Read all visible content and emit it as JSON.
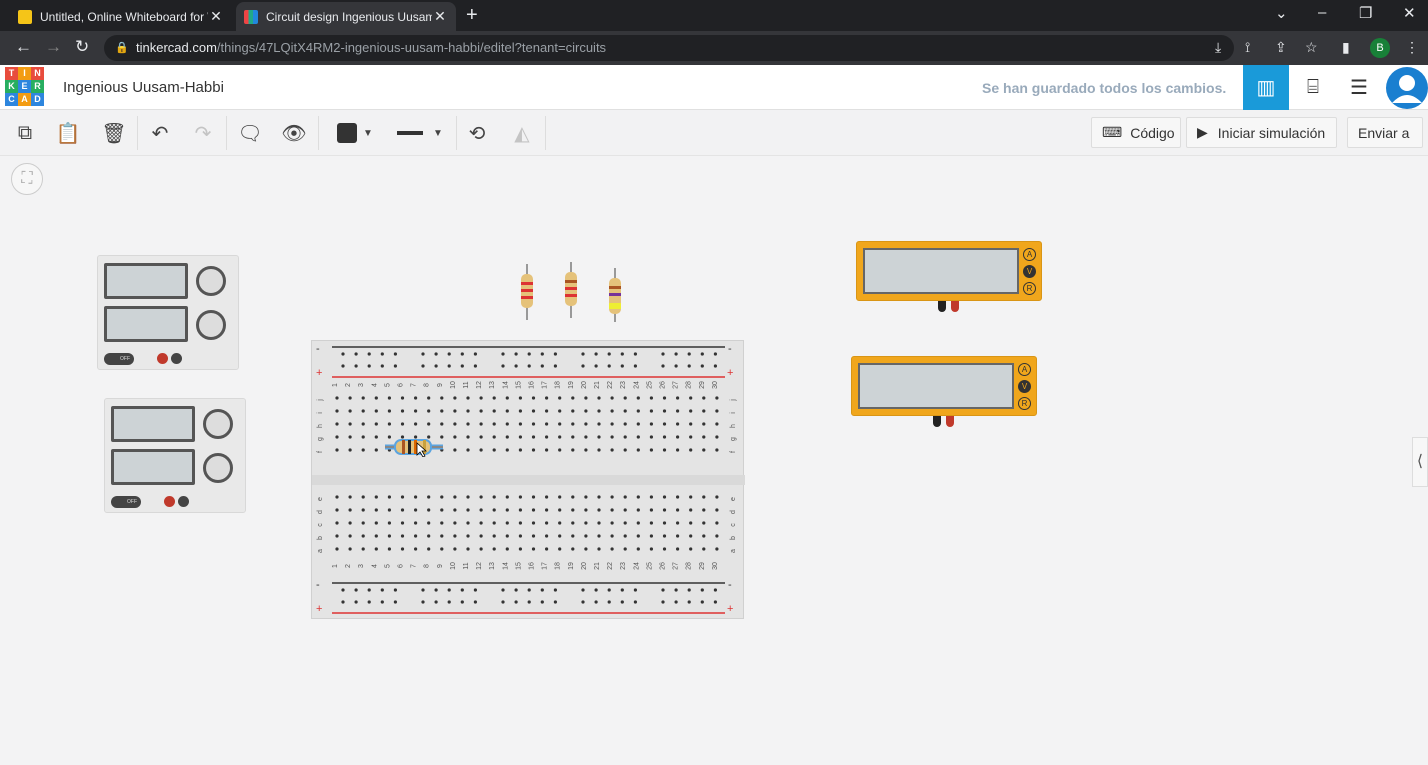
{
  "browser": {
    "tabs": [
      {
        "title": "Untitled, Online Whiteboard for \\",
        "active": false
      },
      {
        "title": "Circuit design Ingenious Uusam-|",
        "active": true
      }
    ],
    "url_host": "tinkercad.com",
    "url_path": "/things/47LQitX4RM2-ingenious-uusam-habbi/editel?tenant=circuits",
    "profile_initial": "B"
  },
  "header": {
    "logo_letters": [
      "T",
      "I",
      "N",
      "K",
      "E",
      "R",
      "C",
      "A",
      "D"
    ],
    "project_name": "Ingenious Uusam-Habbi",
    "save_status": "Se han guardado todos los cambios."
  },
  "toolbar": {
    "code_label": "Código",
    "simulate_label": "Iniciar simulación",
    "send_label": "Enviar a"
  },
  "breadboard": {
    "columns": [
      "1",
      "2",
      "3",
      "4",
      "5",
      "6",
      "7",
      "8",
      "9",
      "10",
      "11",
      "12",
      "13",
      "14",
      "15",
      "16",
      "17",
      "18",
      "19",
      "20",
      "21",
      "22",
      "23",
      "24",
      "25",
      "26",
      "27",
      "28",
      "29",
      "30"
    ],
    "rows_top": [
      "j",
      "i",
      "h",
      "g",
      "f"
    ],
    "rows_bottom": [
      "e",
      "d",
      "c",
      "b",
      "a"
    ],
    "minus": "-",
    "plus": "+"
  },
  "multimeter": {
    "modes": [
      "A",
      "V",
      "R"
    ],
    "selected": "V"
  },
  "psu": {
    "switch_label": "OFF"
  },
  "colors": {
    "accent": "#1a9ad9",
    "multimeter": "#f0a61c",
    "rail_red": "#d33",
    "rail_dark": "#333"
  }
}
